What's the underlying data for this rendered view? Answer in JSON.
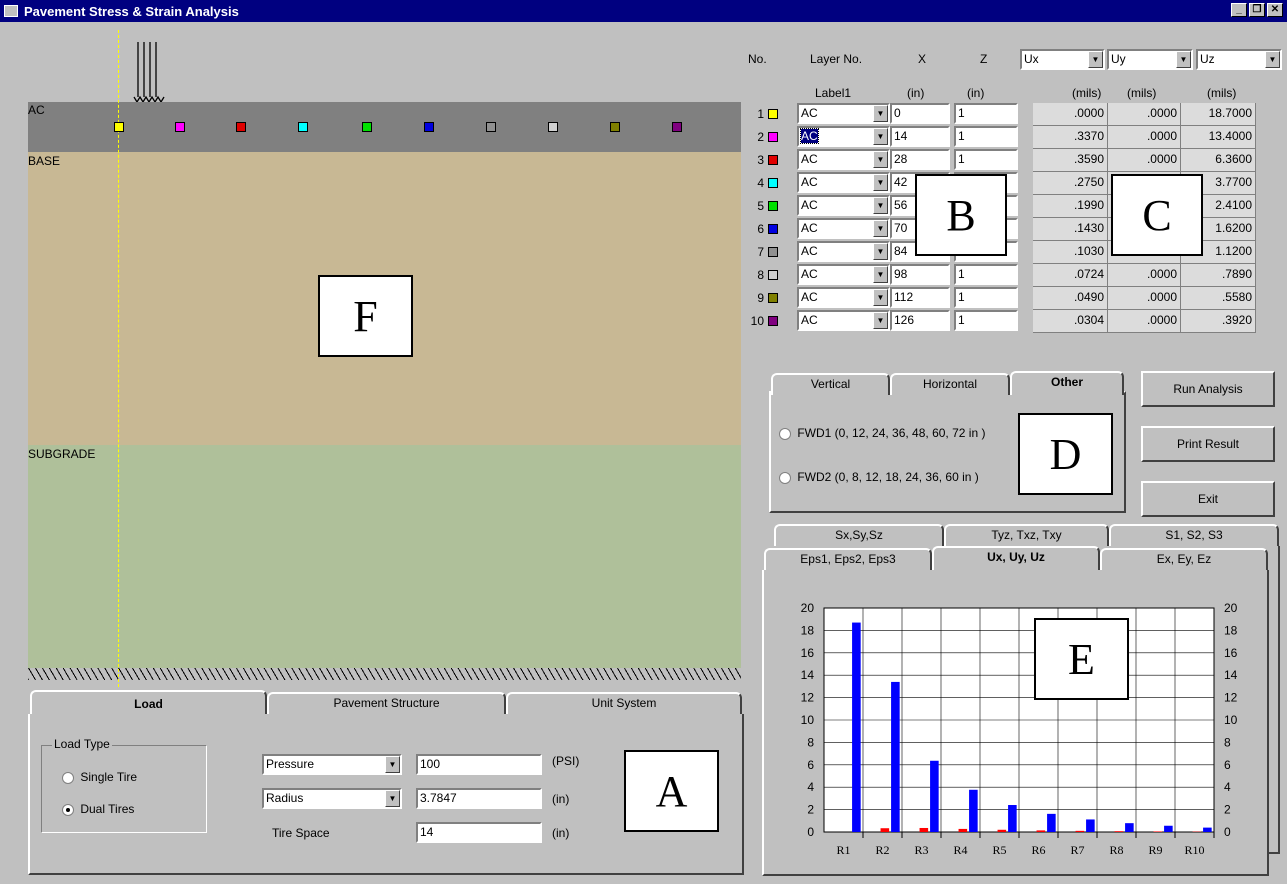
{
  "window": {
    "title": "Pavement Stress & Strain Analysis"
  },
  "colors": {
    "titlebar": "#000080",
    "ac": "#808080",
    "base": "#c8b894",
    "subgrade": "#afc09a",
    "dashed_line": "#ffff00"
  },
  "profile": {
    "layers": [
      {
        "label": "AC"
      },
      {
        "label": "BASE"
      },
      {
        "label": "SUBGRADE"
      }
    ],
    "point_colors": [
      "#ffff00",
      "#ff00ff",
      "#e00000",
      "#00ffff",
      "#00e000",
      "#0000e0",
      "#909090",
      "#d0d0d0",
      "#808000",
      "#800080"
    ]
  },
  "header": {
    "no": "No.",
    "layer_no": "Layer No.",
    "x": "X",
    "z": "Z",
    "sel1": "Ux",
    "sel2": "Uy",
    "sel3": "Uz"
  },
  "subheader": {
    "label1": "Label1",
    "x_unit": "(in)",
    "z_unit": "(in)",
    "u1_unit": "(mils)",
    "u2_unit": "(mils)",
    "u3_unit": "(mils)"
  },
  "rows": [
    {
      "no": "1",
      "layer": "AC",
      "x": "0",
      "z": "1",
      "ux": ".0000",
      "uy": ".0000",
      "uz": "18.7000"
    },
    {
      "no": "2",
      "layer": "AC",
      "x": "14",
      "z": "1",
      "ux": ".3370",
      "uy": ".0000",
      "uz": "13.4000"
    },
    {
      "no": "3",
      "layer": "AC",
      "x": "28",
      "z": "1",
      "ux": ".3590",
      "uy": ".0000",
      "uz": "6.3600"
    },
    {
      "no": "4",
      "layer": "AC",
      "x": "42",
      "z": "",
      "ux": ".2750",
      "uy": "",
      "uz": "3.7700"
    },
    {
      "no": "5",
      "layer": "AC",
      "x": "56",
      "z": "",
      "ux": ".1990",
      "uy": "",
      "uz": "2.4100"
    },
    {
      "no": "6",
      "layer": "AC",
      "x": "70",
      "z": "",
      "ux": ".1430",
      "uy": "",
      "uz": "1.6200"
    },
    {
      "no": "7",
      "layer": "AC",
      "x": "84",
      "z": "1",
      "ux": ".1030",
      "uy": ".0000",
      "uz": "1.1200"
    },
    {
      "no": "8",
      "layer": "AC",
      "x": "98",
      "z": "1",
      "ux": ".0724",
      "uy": ".0000",
      "uz": ".7890"
    },
    {
      "no": "9",
      "layer": "AC",
      "x": "112",
      "z": "1",
      "ux": ".0490",
      "uy": ".0000",
      "uz": ".5580"
    },
    {
      "no": "10",
      "layer": "AC",
      "x": "126",
      "z": "1",
      "ux": ".0304",
      "uy": ".0000",
      "uz": ".3920"
    }
  ],
  "options_tabs": [
    "Vertical",
    "Horizontal",
    "Other"
  ],
  "options": {
    "fwd1": "FWD1  (0, 12, 24, 36, 48, 60, 72 in )",
    "fwd2": "FWD2  (0, 8, 12, 18, 24, 36, 60 in )"
  },
  "buttons": {
    "run": "Run Analysis",
    "print": "Print Result",
    "exit": "Exit"
  },
  "result_tabs_back": [
    "Sx,Sy,Sz",
    "Tyz, Txz, Txy",
    "S1, S2, S3"
  ],
  "result_tabs_front": [
    "Eps1, Eps2, Eps3",
    "Ux, Uy, Uz",
    "Ex, Ey, Ez"
  ],
  "bottom_tabs": [
    "Load",
    "Pavement Structure",
    "Unit System"
  ],
  "load": {
    "load_type_label": "Load Type",
    "single": "Single Tire",
    "dual": "Dual Tires",
    "param1": "Pressure",
    "param1_value": "100",
    "param1_unit": "(PSI)",
    "param2": "Radius",
    "param2_value": "3.7847",
    "param2_unit": "(in)",
    "tire_space_label": "Tire Space",
    "tire_space_value": "14",
    "tire_space_unit": "(in)"
  },
  "annotations": {
    "a": "A",
    "b": "B",
    "c": "C",
    "d": "D",
    "e": "E",
    "f": "F"
  },
  "chart_data": {
    "type": "bar",
    "categories": [
      "R1",
      "R2",
      "R3",
      "R4",
      "R5",
      "R6",
      "R7",
      "R8",
      "R9",
      "R10"
    ],
    "series": [
      {
        "values": [
          0.0,
          0.337,
          0.359,
          0.275,
          0.199,
          0.143,
          0.103,
          0.0724,
          0.049,
          0.0304
        ],
        "color": "#ff0000"
      },
      {
        "values": [
          18.7,
          13.4,
          6.36,
          3.77,
          2.41,
          1.62,
          1.12,
          0.789,
          0.558,
          0.392
        ],
        "color": "#0000ff"
      }
    ],
    "ylim": [
      0,
      20
    ],
    "yticks": [
      0,
      2,
      4,
      6,
      8,
      10,
      12,
      14,
      16,
      18,
      20
    ],
    "grid": true
  }
}
